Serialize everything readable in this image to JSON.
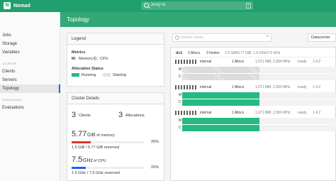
{
  "nav": {
    "brand": "Nomad",
    "search_placeholder": "Jump to",
    "search_hint": "/"
  },
  "page": {
    "title": "Topology"
  },
  "sidebar": {
    "items_top": [
      {
        "label": "Jobs"
      },
      {
        "label": "Storage"
      },
      {
        "label": "Variables"
      }
    ],
    "section_cluster": "CLUSTER",
    "items_cluster": [
      {
        "label": "Clients"
      },
      {
        "label": "Servers"
      },
      {
        "label": "Topology"
      }
    ],
    "section_debugging": "DEBUGGING",
    "items_debug": [
      {
        "label": "Evaluations"
      }
    ]
  },
  "legend": {
    "title": "Legend",
    "metrics_heading": "Metrics",
    "metrics_m": "M:",
    "metrics_m_text": "Memory",
    "metrics_c": "C:",
    "metrics_c_text": "CPU",
    "alloc_status_heading": "Allocation Status",
    "running": "Running",
    "starting": "Starting"
  },
  "cluster_details": {
    "title": "Cluster Details",
    "clients_count": "3",
    "clients_label": "Clients",
    "allocations_count": "3",
    "allocations_label": "Allocations",
    "memory_value": "5.77",
    "memory_unit": "GiB",
    "memory_suffix": "of memory",
    "memory_pct": "26%",
    "memory_fraction": 0.26,
    "memory_reserved": "1.5 GiB / 5.77 GiB reserved",
    "cpu_value": "7.5",
    "cpu_unit": "GHz",
    "cpu_suffix": "of CPU",
    "cpu_pct": "20%",
    "cpu_fraction": 0.2,
    "cpu_reserved": "1.5 GHz / 7.5 GHz reserved",
    "colors": {
      "memory": "#d9362c",
      "cpu": "#1563ff"
    }
  },
  "topology": {
    "filter_placeholder": "Search clients...",
    "filter_clear": "×",
    "datacenter_select": "Datacenter",
    "dc": {
      "name": "dc1",
      "allocs": "3 Allocs",
      "nodes": "3 Nodes",
      "resources": "1.5 GiB/5.77 GiB, 1.5 GHz/7.5 GHz"
    },
    "nodes": [
      {
        "name": "internal",
        "allocs": "1 Allocs",
        "resources": "1,971 MiB, 2,500 MHz",
        "status": "ready",
        "version": "1.4.2",
        "mem_label": "M",
        "cpu_label": "C",
        "mem_fill": 0.5,
        "cpu_fill": 0.5,
        "state": "starting"
      },
      {
        "name": "internal",
        "allocs": "1 Allocs",
        "resources": "1,971 MiB, 2,500 MHz",
        "status": "ready",
        "version": "1.4.2",
        "mem_label": "M",
        "cpu_label": "C",
        "mem_fill": 0.5,
        "cpu_fill": 0.5,
        "state": "running"
      },
      {
        "name": "internal",
        "allocs": "1 Allocs",
        "resources": "1,971 MiB, 2,500 MHz",
        "status": "ready",
        "version": "1.4.2",
        "mem_label": "M",
        "cpu_label": "C",
        "mem_fill": 0.5,
        "cpu_fill": 0.5,
        "state": "running"
      }
    ]
  },
  "colors": {
    "brand": "#1f9f6d",
    "running": "#25ba81",
    "active_nav": "#1563ff"
  }
}
